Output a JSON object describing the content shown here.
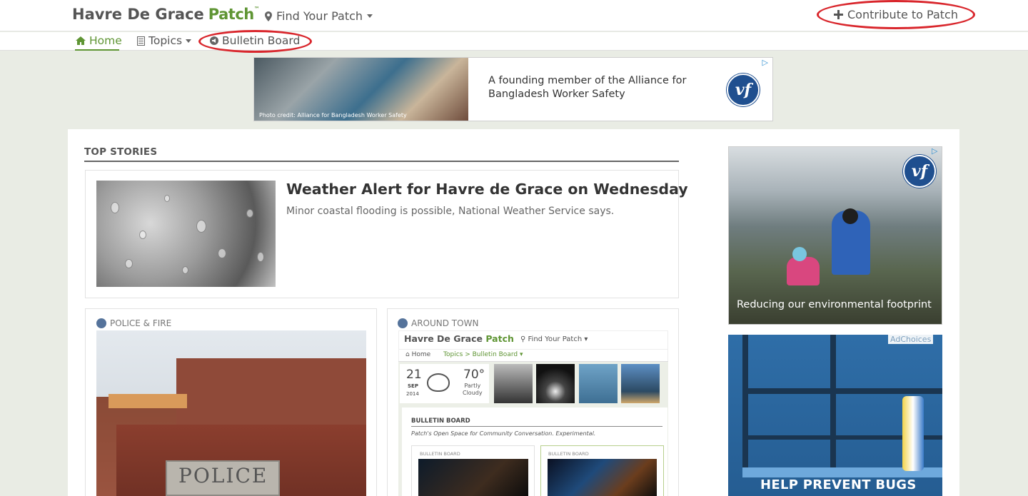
{
  "header": {
    "site_name": "Havre De Grace",
    "brand": "Patch",
    "find_patch": "Find Your Patch",
    "contribute": "Contribute to Patch"
  },
  "nav": {
    "home": "Home",
    "topics": "Topics",
    "bulletin_board": "Bulletin Board"
  },
  "banner_ad": {
    "photo_credit": "Photo credit: Alliance for Bangladesh Worker Safety",
    "text": "A founding member of the Alliance for Bangladesh Worker Safety",
    "logo": "vf",
    "adchoices_icon": "▷"
  },
  "top_stories": {
    "label": "TOP STORIES",
    "lead": {
      "title": "Weather Alert for Havre de Grace on Wednesday",
      "summary": "Minor coastal flooding is possible, National Weather Service says."
    },
    "cards": [
      {
        "category": "POLICE & FIRE",
        "sign_text": "POLICE"
      },
      {
        "category": "AROUND TOWN"
      }
    ]
  },
  "mini_screenshot": {
    "site_name": "Havre De Grace",
    "brand": "Patch",
    "find_patch": "Find Your Patch",
    "home": "Home",
    "topics": "Topics",
    "separator": ">",
    "bulletin_board": "Bulletin Board",
    "day": "21",
    "month": "SEP",
    "year": "2014",
    "temp": "70°",
    "condition_1": "Partly",
    "condition_2": "Cloudy",
    "section": "BULLETIN BOARD",
    "description": "Patch's Open Space for Community Conversation. Experimental.",
    "card_label_1": "BULLETIN BOARD",
    "card_label_2": "BULLETIN BOARD"
  },
  "sidebar_ads": {
    "ad1_caption": "Reducing our environmental footprint",
    "ad1_logo": "vf",
    "ad1_adchoices": "▷",
    "ad2_adchoices": "AdChoices",
    "ad2_text": "HELP PREVENT BUGS"
  },
  "colors": {
    "accent": "#5f9534",
    "highlight_oval": "#d9262c"
  }
}
